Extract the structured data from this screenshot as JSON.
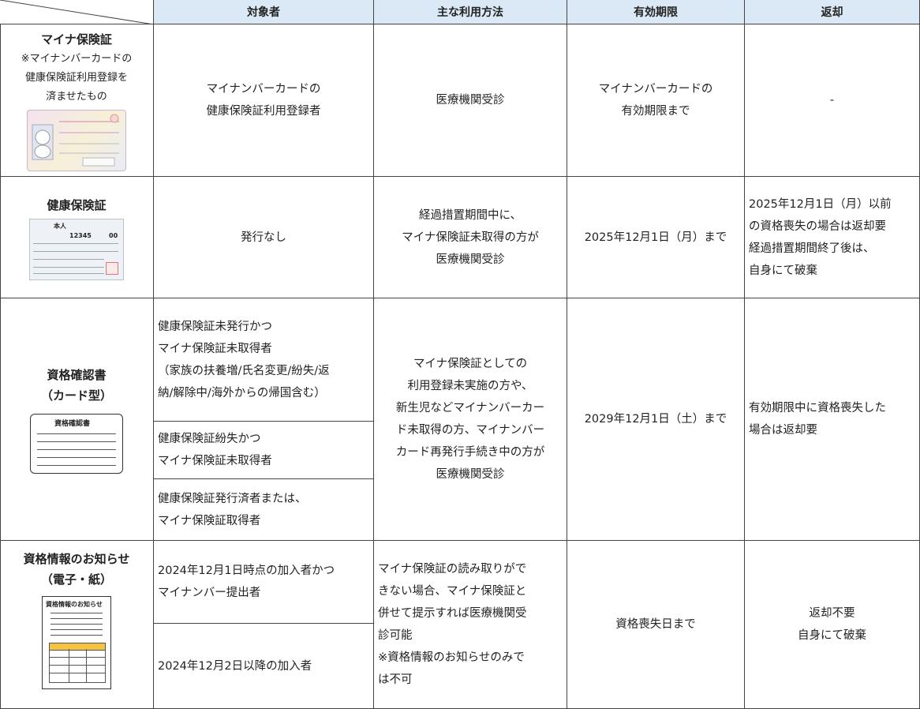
{
  "headers": {
    "target": "対象者",
    "usage": "主な利用方法",
    "validity": "有効期限",
    "return": "返却"
  },
  "rows": {
    "myna": {
      "title": "マイナ保険証",
      "note": [
        "※マイナンバーカードの",
        "健康保険証利用登録を",
        "済ませたもの"
      ],
      "card_icon": "mynumber-card-illustration",
      "target": [
        "マイナンバーカードの",
        "健康保険証利用登録者"
      ],
      "usage": [
        "医療機関受診"
      ],
      "validity": [
        "マイナンバーカードの",
        "有効期限まで"
      ],
      "return": [
        "-"
      ]
    },
    "hoken": {
      "title": "健康保険証",
      "card_icon": "health-insurance-card-illustration",
      "card_text": [
        "本人",
        "12345",
        "00"
      ],
      "target": [
        "発行なし"
      ],
      "usage": [
        "経過措置期間中に、",
        "マイナ保険証未取得の方が",
        "医療機関受診"
      ],
      "validity": [
        "2025年12月1日（月）まで"
      ],
      "return": [
        "2025年12月1日（月）以前",
        "の資格喪失の場合は返却要",
        "経過措置期間終了後は、",
        "自身にて破棄"
      ]
    },
    "shikaku": {
      "title": [
        "資格確認書",
        "（カード型）"
      ],
      "card_icon": "qualification-card-illustration",
      "card_label": "資格確認書",
      "targets": [
        [
          "健康保険証未発行かつ",
          "マイナ保険証未取得者",
          "（家族の扶養増/氏名変更/紛失/返",
          "納/解除中/海外からの帰国含む）"
        ],
        [
          "健康保険証紛失かつ",
          "マイナ保険証未取得者"
        ],
        [
          "健康保険証発行済者または、",
          "マイナ保険証取得者"
        ]
      ],
      "usage": [
        "マイナ保険証としての",
        "利用登録未実施の方や、",
        "新生児などマイナンバーカー",
        "ド未取得の方、マイナンバー",
        "カード再発行手続き中の方が",
        "医療機関受診"
      ],
      "validity": [
        "2029年12月1日（土）まで"
      ],
      "return": [
        "有効期限中に資格喪失した",
        "場合は返却要"
      ]
    },
    "oshirase": {
      "title": [
        "資格情報のお知らせ",
        "（電子・紙）"
      ],
      "card_icon": "qualification-notice-illustration",
      "card_label": "資格情報のお知らせ",
      "targets": [
        [
          "2024年12月1日時点の加入者かつ",
          "マイナンバー提出者"
        ],
        [
          "2024年12月2日以降の加入者"
        ]
      ],
      "usage": [
        "マイナ保険証の読み取りがで",
        "きない場合、マイナ保険証と",
        "併せて提示すれば医療機関受",
        "診可能",
        "※資格情報のお知らせのみで",
        "は不可"
      ],
      "validity": [
        "資格喪失日まで"
      ],
      "return": [
        "返却不要",
        "自身にて破棄"
      ]
    }
  },
  "colors": {
    "header_bg": "#dbe8f5",
    "border": "#444444",
    "notice_highlight": "#f5c242"
  }
}
